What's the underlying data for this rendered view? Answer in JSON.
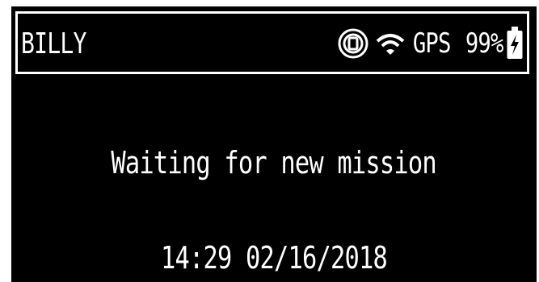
{
  "device": {
    "name": "BILLY"
  },
  "status_bar": {
    "vibration_icon": "vibrate-icon",
    "wifi_icon": "wifi-icon",
    "gps_label": "GPS",
    "battery_label": "99%",
    "battery_icon": "battery-charging-icon"
  },
  "main": {
    "message": "Waiting for new mission",
    "datetime": "14:29 02/16/2018"
  },
  "colors": {
    "background": "#000000",
    "foreground": "#ffffff"
  }
}
